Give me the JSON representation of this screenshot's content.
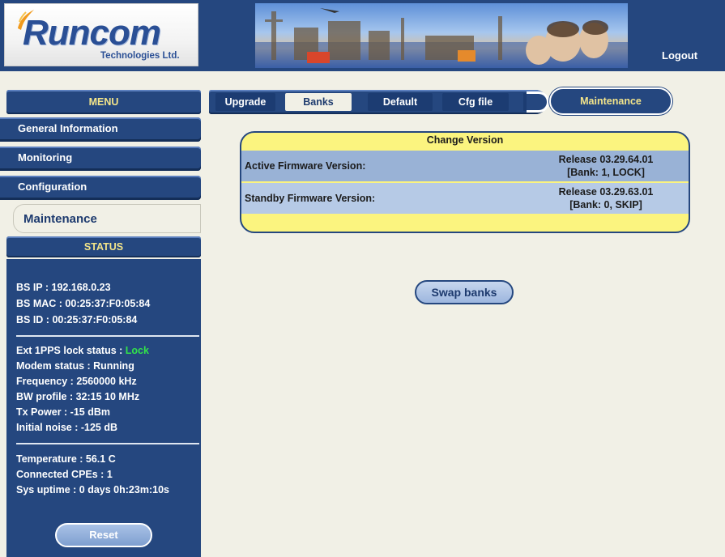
{
  "header": {
    "brand": "Runcom",
    "brand_sub": "Technologies Ltd.",
    "logout_label": "Logout"
  },
  "menu": {
    "title": "MENU",
    "tabs": [
      {
        "label": "Upgrade"
      },
      {
        "label": "Banks"
      },
      {
        "label": "Default"
      },
      {
        "label": "Cfg file"
      }
    ],
    "section_label": "Maintenance"
  },
  "sidebar": {
    "items": [
      {
        "label": "General Information"
      },
      {
        "label": "Monitoring"
      },
      {
        "label": "Configuration"
      },
      {
        "label": "Maintenance"
      }
    ]
  },
  "status": {
    "title": "STATUS",
    "bs_ip": "BS IP : 192.168.0.23",
    "bs_mac": "BS MAC : 00:25:37:F0:05:84",
    "bs_id": "BS ID : 00:25:37:F0:05:84",
    "ext_lock_label": "Ext 1PPS lock status : ",
    "ext_lock_value": "Lock",
    "modem": "Modem status : Running",
    "frequency": "Frequency : 2560000 kHz",
    "bw_profile": "BW profile : 32:15 10 MHz",
    "tx_power": "Tx Power : -15 dBm",
    "initial_noise": "Initial noise : -125 dB",
    "temperature": "Temperature : 56.1 C",
    "connected_cpes": "Connected CPEs : 1",
    "uptime": "Sys uptime : 0 days 0h:23m:10s",
    "reset_label": "Reset"
  },
  "change_version": {
    "title": "Change Version",
    "rows": [
      {
        "label": "Active Firmware Version:",
        "release": "Release 03.29.64.01",
        "bank": "[Bank: 1, LOCK]"
      },
      {
        "label": "Standby Firmware Version:",
        "release": "Release 03.29.63.01",
        "bank": "[Bank: 0, SKIP]"
      }
    ],
    "swap_label": "Swap banks"
  },
  "colors": {
    "navy": "#25477f",
    "accent_yellow": "#f4e58a",
    "panel_yellow": "#fbf47f",
    "lock_green": "#32e24a",
    "page_bg": "#f1f0e6"
  }
}
